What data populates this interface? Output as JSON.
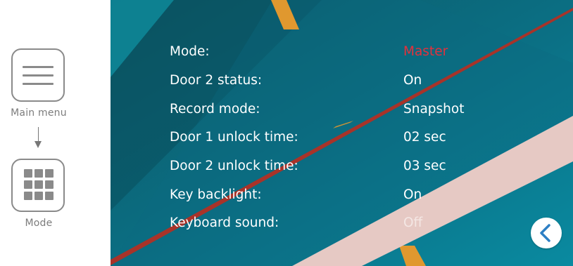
{
  "steps": {
    "main_menu_label": "Main menu",
    "mode_label": "Mode"
  },
  "settings": [
    {
      "key": "Mode:",
      "value": "Master"
    },
    {
      "key": "Door 2 status:",
      "value": "On"
    },
    {
      "key": "Record mode:",
      "value": "Snapshot"
    },
    {
      "key": "Door 1 unlock time:",
      "value": "02 sec"
    },
    {
      "key": "Door 2 unlock time:",
      "value": "03 sec"
    },
    {
      "key": "Key backlight:",
      "value": "On"
    },
    {
      "key": "Keyboard sound:",
      "value": "Off"
    }
  ],
  "icons": {
    "menu": "hamburger-icon",
    "mode": "grid-icon",
    "flow": "arrow-down-icon",
    "back": "chevron-left-icon"
  },
  "colors": {
    "accent": "#e3313c",
    "screen_bg": "#0a6f84",
    "stripe_orange": "#e0982f",
    "stripe_pink": "#e6c9c4",
    "stripe_red": "#a83329",
    "icon_gray": "#8a8a8a"
  }
}
